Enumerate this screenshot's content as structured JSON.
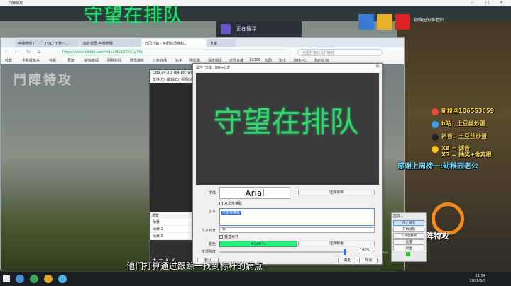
{
  "player": {
    "title": "鬥陣特攻"
  },
  "overlay": {
    "title": "守望在排队"
  },
  "search_badge": {
    "label": "正在搜寻"
  },
  "streamer": {
    "name": "幼稚园的蒂老师"
  },
  "browser": {
    "tabs": [
      {
        "label": "哔哩哔哩 ( ゜- ゜)つロ 干杯~-..."
      },
      {
        "label": "综合首页-哔哩哔哩"
      },
      {
        "label": "齐国方镇 - 各组织坦克和..."
      },
      {
        "label": "卡菜"
      }
    ],
    "url": "https://www.bilibili.com/video/BV1Z6Ky1g7Ks",
    "search_placeholder": "全国打渔对话开路线",
    "bookmarks": [
      "收藏",
      "手机收藏夹",
      "谷歌",
      "百度",
      "新浪新闻",
      "网易新闻",
      "腾讯播放",
      "斗鱼直播",
      "知乎",
      "电影推",
      "百度翻译",
      "虎牙直播",
      "12306",
      "优酷",
      "淘宝",
      "游戏中心",
      "我的文档"
    ]
  },
  "watermark": "鬥陣特攻",
  "subtitle": "他们打算通过跟踪一找到标杆的病点",
  "obs": {
    "title": "OBS 24.0.3 (64-bit, windows)",
    "menu": [
      "文件(F)",
      "编辑(E)",
      "视图(V)"
    ],
    "scenes_header": "场景",
    "scenes": [
      "场景",
      "场景 2",
      "场景 3"
    ],
    "scene_tools": "+ − ∧ ∨",
    "controls_header": "控件",
    "controls": [
      "停止推流",
      "开始录制",
      "工作室模式",
      "设置",
      "退出"
    ],
    "status_fps": "fps"
  },
  "dialog": {
    "title": "属性 '文本 (GDI+) 3'",
    "font_label": "字体",
    "font_value": "Arial",
    "choose_font": "选择字体",
    "from_file": "从文件读取",
    "text_label": "文本",
    "text_value": "守望在排队",
    "align_label": "文本对齐",
    "align_value": "左",
    "vertical": "垂直对齐",
    "color_label": "颜色",
    "color_value": "#1df57a",
    "choose_color": "选择颜色",
    "opacity_label": "不透明度",
    "opacity": 100,
    "opacity_text": "100%",
    "defaults": "默认",
    "ok": "确定",
    "cancel": "取消"
  },
  "gifts": [
    {
      "text": "新粉丝106553659",
      "color": "#e74c3c"
    },
    {
      "text": "b站：土豆丝炒蛋",
      "color": "#3aa0e8"
    },
    {
      "text": "抖音：土豆丝炒蛋",
      "color": "#222"
    },
    {
      "text": "X8 = 调音",
      "color": "#f5c518"
    },
    {
      "text": "X3 = 抽奖+舍弃跟",
      "color": "#e74c3c"
    }
  ],
  "thanks": "感谢上周榜一:幼稚园老公",
  "game_text": "阵特攻",
  "clock": {
    "time": "21:54",
    "date": "2021/6/3"
  }
}
